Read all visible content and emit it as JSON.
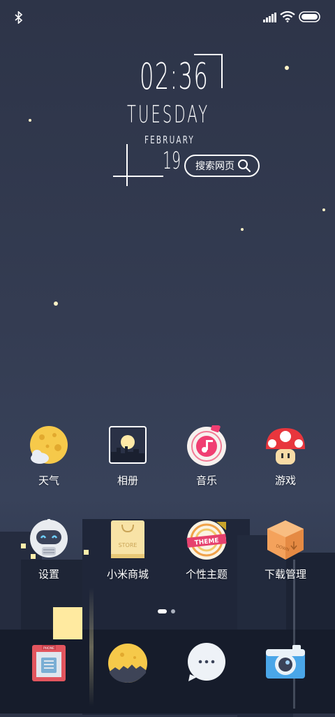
{
  "status_bar": {
    "icons": [
      "bluetooth-icon",
      "signal-icon",
      "wifi-icon",
      "battery-icon"
    ]
  },
  "clock": {
    "time": "02:36",
    "day": "TUESDAY",
    "month": "FEBRUARY",
    "date": "19"
  },
  "search": {
    "label": "搜索网页",
    "icon": "search-icon"
  },
  "apps_row1": [
    {
      "label": "天气",
      "icon": "weather-moon-icon"
    },
    {
      "label": "相册",
      "icon": "gallery-icon"
    },
    {
      "label": "音乐",
      "icon": "music-icon"
    },
    {
      "label": "游戏",
      "icon": "mushroom-game-icon"
    }
  ],
  "apps_row2": [
    {
      "label": "设置",
      "icon": "robot-settings-icon"
    },
    {
      "label": "小米商城",
      "icon": "store-bag-icon"
    },
    {
      "label": "个性主题",
      "icon": "theme-icon"
    },
    {
      "label": "下载管理",
      "icon": "download-box-icon"
    }
  ],
  "store_icon_text": "STORE",
  "theme_icon_text": "THEME",
  "download_icon_text": "DOWN",
  "phone_icon_text": "PHONE",
  "dock": [
    {
      "icon": "phone-icon"
    },
    {
      "icon": "browser-moon-icon"
    },
    {
      "icon": "messages-icon"
    },
    {
      "icon": "camera-icon"
    }
  ],
  "page_indicator": {
    "pages": 2,
    "current": 1
  }
}
